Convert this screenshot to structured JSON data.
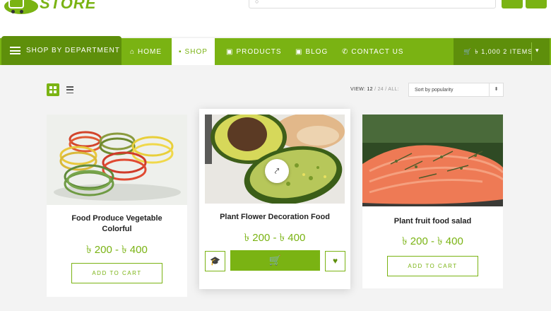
{
  "brand": {
    "name": "STORE",
    "color": "#7ab313",
    "dark": "#5e8f0b"
  },
  "search": {
    "placeholder": ""
  },
  "nav": {
    "department": "SHOP BY DEPARTMENT",
    "items": [
      {
        "label": "HOME",
        "icon": "home-icon"
      },
      {
        "label": "SHOP",
        "icon": "bag-icon"
      },
      {
        "label": "PRODUCTS",
        "icon": "box-icon"
      },
      {
        "label": "BLOG",
        "icon": "blog-icon"
      },
      {
        "label": "CONTACT US",
        "icon": "phone-icon"
      }
    ],
    "active": "SHOP",
    "cart": "৳ 1,000  2 ITEMS"
  },
  "toolbar": {
    "view_label": "VIEW:",
    "view_options": [
      "12",
      "24",
      "ALL"
    ],
    "view_selected": "12",
    "sort_value": "Sort by popularity"
  },
  "products": [
    {
      "title_line1": "Food Produce Vegetable",
      "title_line2": "Colorful",
      "price": "৳ 200 - ৳ 400",
      "button": "ADD TO CART"
    },
    {
      "title_line1": "Plant Flower Decoration Food",
      "title_line2": "",
      "price": "৳ 200 - ৳ 400",
      "button": ""
    },
    {
      "title_line1": "Plant fruit food salad",
      "title_line2": "",
      "price": "৳ 200 - ৳ 400",
      "button": "ADD TO CART"
    }
  ]
}
